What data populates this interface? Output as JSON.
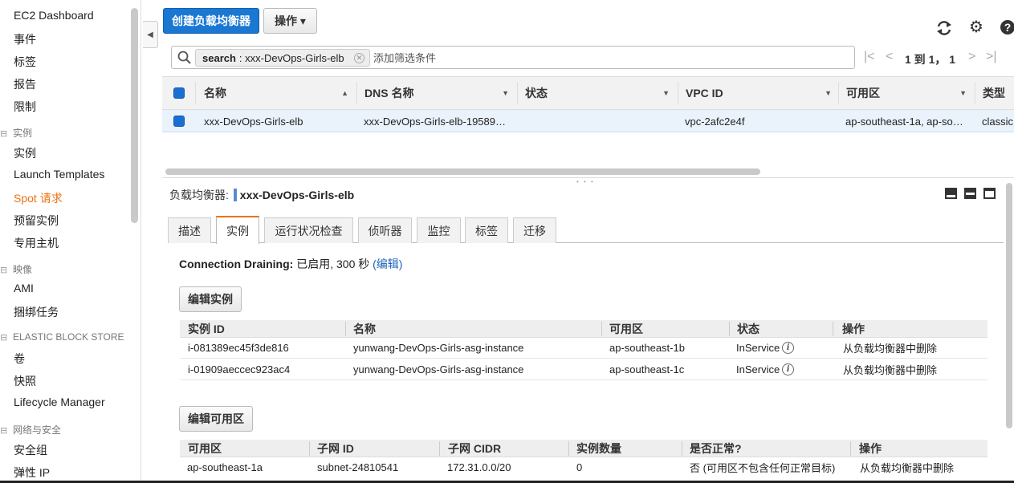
{
  "sidebar": {
    "items": [
      {
        "label": "EC2 Dashboard"
      },
      {
        "label": "事件"
      },
      {
        "label": "标签"
      },
      {
        "label": "报告"
      },
      {
        "label": "限制"
      }
    ],
    "sections": [
      {
        "title": "实例",
        "items": [
          "实例",
          "Launch Templates",
          "Spot 请求",
          "预留实例",
          "专用主机"
        ]
      },
      {
        "title": "映像",
        "items": [
          "AMI",
          "捆绑任务"
        ]
      },
      {
        "title": "ELASTIC BLOCK STORE",
        "items": [
          "卷",
          "快照",
          "Lifecycle Manager"
        ]
      },
      {
        "title": "网络与安全",
        "items": [
          "安全组",
          "弹性 IP"
        ]
      }
    ],
    "toggle_glyph": "⊟"
  },
  "toolbar": {
    "create_label": "创建负载均衡器",
    "actions_label": "操作 ▾"
  },
  "search": {
    "chip_key": "search",
    "chip_value": ": xxx-DevOps-Girls-elb",
    "placeholder": "添加筛选条件"
  },
  "pagination": {
    "text": "1 到 1， 1"
  },
  "main_table": {
    "columns": [
      "名称",
      "DNS 名称",
      "状态",
      "VPC ID",
      "可用区",
      "类型"
    ],
    "row": {
      "name": "xxx-DevOps-Girls-elb",
      "dns": "xxx-DevOps-Girls-elb-19589…",
      "status": "",
      "vpc": "vpc-2afc2e4f",
      "az": "ap-southeast-1a, ap-so…",
      "type": "classic"
    }
  },
  "detail": {
    "title_prefix": "负载均衡器:",
    "title_name": "xxx-DevOps-Girls-elb",
    "tabs": [
      "描述",
      "实例",
      "运行状况检查",
      "侦听器",
      "监控",
      "标签",
      "迁移"
    ],
    "active_tab": "实例",
    "draining_label": "Connection Draining:",
    "draining_value": " 已启用, 300 秒 ",
    "draining_edit": "(编辑)",
    "edit_instances_label": "编辑实例",
    "instances_columns": [
      "实例 ID",
      "名称",
      "可用区",
      "状态",
      "操作"
    ],
    "instances": [
      {
        "id": "i-081389ec45f3de816",
        "name": "yunwang-DevOps-Girls-asg-instance",
        "az": "ap-southeast-1b",
        "state": "InService",
        "action": "从负载均衡器中删除"
      },
      {
        "id": "i-01909aeccec923ac4",
        "name": "yunwang-DevOps-Girls-asg-instance",
        "az": "ap-southeast-1c",
        "state": "InService",
        "action": "从负载均衡器中删除"
      }
    ],
    "edit_az_label": "编辑可用区",
    "az_columns": [
      "可用区",
      "子网 ID",
      "子网 CIDR",
      "实例数量",
      "是否正常?",
      "操作"
    ],
    "az_rows": [
      {
        "az": "ap-southeast-1a",
        "subnet": "subnet-24810541",
        "cidr": "172.31.0.0/20",
        "count": "0",
        "healthy": "否 (可用区不包含任何正常目标)",
        "action": "从负载均衡器中删除"
      }
    ]
  },
  "colors": {
    "primary": "#1a77d2",
    "accent": "#ec7211",
    "link": "#1a63b8"
  }
}
